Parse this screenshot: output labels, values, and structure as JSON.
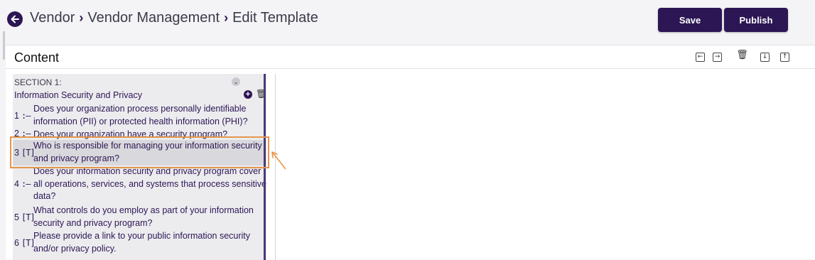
{
  "breadcrumb": {
    "items": [
      "Vendor",
      "Vendor Management",
      "Edit Template"
    ],
    "separator": "›"
  },
  "toolbar": {
    "save_label": "Save",
    "publish_label": "Publish"
  },
  "content": {
    "title": "Content"
  },
  "section": {
    "label": "SECTION 1:",
    "title": "Information Security and Privacy",
    "questions": [
      {
        "number": "1",
        "type_icon": "list-icon",
        "text": "Does your organization process personally identifiable information (PII) or protected health information (PHI)?"
      },
      {
        "number": "2",
        "type_icon": "list-icon",
        "text": "Does your organization have a security program?"
      },
      {
        "number": "3",
        "type_icon": "text-field-icon",
        "text": "Who is responsible for managing your information security and privacy program?"
      },
      {
        "number": "4",
        "type_icon": "list-icon",
        "text": "Does your information security and privacy program cover all operations, services, and systems that process sensitive data?"
      },
      {
        "number": "5",
        "type_icon": "text-field-icon",
        "text": "What controls do you employ as part of your information security and privacy program?"
      },
      {
        "number": "6",
        "type_icon": "text-field-icon",
        "text": "Please provide a link to your public information security and/or privacy policy."
      }
    ]
  },
  "colors": {
    "brand": "#2c1654",
    "highlight": "#e4964a",
    "selected_row": "#d9d9dd"
  }
}
